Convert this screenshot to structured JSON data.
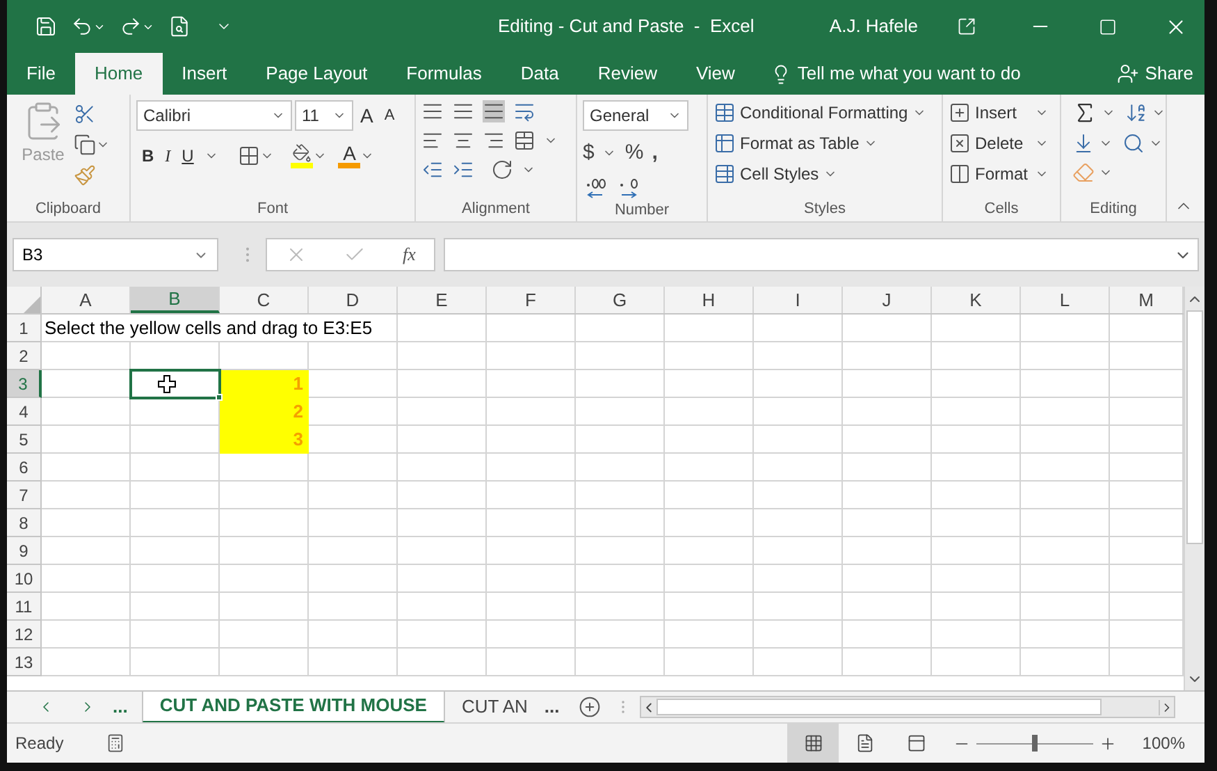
{
  "window": {
    "title": "Editing - Cut and Paste  -  Excel",
    "user": "A.J. Hafele"
  },
  "tabs": [
    {
      "label": "File",
      "selected": false
    },
    {
      "label": "Home",
      "selected": true
    },
    {
      "label": "Insert",
      "selected": false
    },
    {
      "label": "Page Layout",
      "selected": false
    },
    {
      "label": "Formulas",
      "selected": false
    },
    {
      "label": "Data",
      "selected": false
    },
    {
      "label": "Review",
      "selected": false
    },
    {
      "label": "View",
      "selected": false
    }
  ],
  "tell_me": {
    "placeholder": "Tell me what you want to do"
  },
  "share": "Share",
  "ribbon": {
    "clipboard": {
      "label": "Clipboard",
      "paste": "Paste"
    },
    "font": {
      "label": "Font",
      "name": "Calibri",
      "size": "11",
      "grow": "A",
      "shrink": "A",
      "bold": "B",
      "italic": "I",
      "underline": "U",
      "font_color": "A"
    },
    "alignment": {
      "label": "Alignment"
    },
    "number": {
      "label": "Number",
      "format": "General",
      "currency": "$",
      "percent": "%",
      "comma": ","
    },
    "styles": {
      "label": "Styles",
      "items": [
        "Conditional Formatting",
        "Format as Table",
        "Cell Styles"
      ]
    },
    "cells": {
      "label": "Cells",
      "items": [
        "Insert",
        "Delete",
        "Format"
      ]
    },
    "editing": {
      "label": "Editing"
    }
  },
  "formula_bar": {
    "name_box": "B3",
    "function_label": "fx"
  },
  "columns": [
    {
      "label": "A",
      "selected": false
    },
    {
      "label": "B",
      "selected": true
    },
    {
      "label": "C",
      "selected": false
    },
    {
      "label": "D",
      "selected": false
    },
    {
      "label": "E",
      "selected": false
    },
    {
      "label": "F",
      "selected": false
    },
    {
      "label": "G",
      "selected": false
    },
    {
      "label": "H",
      "selected": false
    },
    {
      "label": "I",
      "selected": false
    },
    {
      "label": "J",
      "selected": false
    },
    {
      "label": "K",
      "selected": false
    },
    {
      "label": "L",
      "selected": false
    },
    {
      "label": "M",
      "selected": false
    }
  ],
  "rows": [
    {
      "label": "1",
      "selected": false,
      "cells": [
        {
          "kind": "text",
          "text": "Select the yellow cells and drag to E3:E5",
          "selected": false
        },
        {
          "kind": "empty",
          "selected": false
        },
        {
          "kind": "empty",
          "selected": false
        },
        {
          "kind": "empty",
          "selected": false
        },
        {
          "kind": "empty",
          "selected": false
        },
        {
          "kind": "empty",
          "selected": false
        },
        {
          "kind": "empty",
          "selected": false
        },
        {
          "kind": "empty",
          "selected": false
        },
        {
          "kind": "empty",
          "selected": false
        },
        {
          "kind": "empty",
          "selected": false
        },
        {
          "kind": "empty",
          "selected": false
        },
        {
          "kind": "empty",
          "selected": false
        },
        {
          "kind": "empty",
          "selected": false
        }
      ]
    },
    {
      "label": "2",
      "selected": false,
      "cells": [
        {
          "kind": "empty",
          "selected": false
        },
        {
          "kind": "empty",
          "selected": false
        },
        {
          "kind": "empty",
          "selected": false
        },
        {
          "kind": "empty",
          "selected": false
        },
        {
          "kind": "empty",
          "selected": false
        },
        {
          "kind": "empty",
          "selected": false
        },
        {
          "kind": "empty",
          "selected": false
        },
        {
          "kind": "empty",
          "selected": false
        },
        {
          "kind": "empty",
          "selected": false
        },
        {
          "kind": "empty",
          "selected": false
        },
        {
          "kind": "empty",
          "selected": false
        },
        {
          "kind": "empty",
          "selected": false
        },
        {
          "kind": "empty",
          "selected": false
        }
      ]
    },
    {
      "label": "3",
      "selected": true,
      "cells": [
        {
          "kind": "empty",
          "selected": false
        },
        {
          "kind": "empty",
          "selected": true
        },
        {
          "kind": "number",
          "text": "1",
          "color": "#ffff00",
          "selected": false
        },
        {
          "kind": "empty",
          "selected": false
        },
        {
          "kind": "empty",
          "selected": false
        },
        {
          "kind": "empty",
          "selected": false
        },
        {
          "kind": "empty",
          "selected": false
        },
        {
          "kind": "empty",
          "selected": false
        },
        {
          "kind": "empty",
          "selected": false
        },
        {
          "kind": "empty",
          "selected": false
        },
        {
          "kind": "empty",
          "selected": false
        },
        {
          "kind": "empty",
          "selected": false
        },
        {
          "kind": "empty",
          "selected": false
        }
      ]
    },
    {
      "label": "4",
      "selected": false,
      "cells": [
        {
          "kind": "empty",
          "selected": false
        },
        {
          "kind": "empty",
          "selected": false
        },
        {
          "kind": "number",
          "text": "2",
          "color": "#ffff00",
          "selected": false
        },
        {
          "kind": "empty",
          "selected": false
        },
        {
          "kind": "empty",
          "selected": false
        },
        {
          "kind": "empty",
          "selected": false
        },
        {
          "kind": "empty",
          "selected": false
        },
        {
          "kind": "empty",
          "selected": false
        },
        {
          "kind": "empty",
          "selected": false
        },
        {
          "kind": "empty",
          "selected": false
        },
        {
          "kind": "empty",
          "selected": false
        },
        {
          "kind": "empty",
          "selected": false
        },
        {
          "kind": "empty",
          "selected": false
        }
      ]
    },
    {
      "label": "5",
      "selected": false,
      "cells": [
        {
          "kind": "empty",
          "selected": false
        },
        {
          "kind": "empty",
          "selected": false
        },
        {
          "kind": "number",
          "text": "3",
          "color": "#ffff00",
          "selected": false
        },
        {
          "kind": "empty",
          "selected": false
        },
        {
          "kind": "empty",
          "selected": false
        },
        {
          "kind": "empty",
          "selected": false
        },
        {
          "kind": "empty",
          "selected": false
        },
        {
          "kind": "empty",
          "selected": false
        },
        {
          "kind": "empty",
          "selected": false
        },
        {
          "kind": "empty",
          "selected": false
        },
        {
          "kind": "empty",
          "selected": false
        },
        {
          "kind": "empty",
          "selected": false
        },
        {
          "kind": "empty",
          "selected": false
        }
      ]
    },
    {
      "label": "6",
      "selected": false,
      "cells": [
        {
          "kind": "empty",
          "selected": false
        },
        {
          "kind": "empty",
          "selected": false
        },
        {
          "kind": "empty",
          "selected": false
        },
        {
          "kind": "empty",
          "selected": false
        },
        {
          "kind": "empty",
          "selected": false
        },
        {
          "kind": "empty",
          "selected": false
        },
        {
          "kind": "empty",
          "selected": false
        },
        {
          "kind": "empty",
          "selected": false
        },
        {
          "kind": "empty",
          "selected": false
        },
        {
          "kind": "empty",
          "selected": false
        },
        {
          "kind": "empty",
          "selected": false
        },
        {
          "kind": "empty",
          "selected": false
        },
        {
          "kind": "empty",
          "selected": false
        }
      ]
    },
    {
      "label": "7",
      "selected": false,
      "cells": [
        {
          "kind": "empty",
          "selected": false
        },
        {
          "kind": "empty",
          "selected": false
        },
        {
          "kind": "empty",
          "selected": false
        },
        {
          "kind": "empty",
          "selected": false
        },
        {
          "kind": "empty",
          "selected": false
        },
        {
          "kind": "empty",
          "selected": false
        },
        {
          "kind": "empty",
          "selected": false
        },
        {
          "kind": "empty",
          "selected": false
        },
        {
          "kind": "empty",
          "selected": false
        },
        {
          "kind": "empty",
          "selected": false
        },
        {
          "kind": "empty",
          "selected": false
        },
        {
          "kind": "empty",
          "selected": false
        },
        {
          "kind": "empty",
          "selected": false
        }
      ]
    },
    {
      "label": "8",
      "selected": false,
      "cells": [
        {
          "kind": "empty",
          "selected": false
        },
        {
          "kind": "empty",
          "selected": false
        },
        {
          "kind": "empty",
          "selected": false
        },
        {
          "kind": "empty",
          "selected": false
        },
        {
          "kind": "empty",
          "selected": false
        },
        {
          "kind": "empty",
          "selected": false
        },
        {
          "kind": "empty",
          "selected": false
        },
        {
          "kind": "empty",
          "selected": false
        },
        {
          "kind": "empty",
          "selected": false
        },
        {
          "kind": "empty",
          "selected": false
        },
        {
          "kind": "empty",
          "selected": false
        },
        {
          "kind": "empty",
          "selected": false
        },
        {
          "kind": "empty",
          "selected": false
        }
      ]
    },
    {
      "label": "9",
      "selected": false,
      "cells": [
        {
          "kind": "empty",
          "selected": false
        },
        {
          "kind": "empty",
          "selected": false
        },
        {
          "kind": "empty",
          "selected": false
        },
        {
          "kind": "empty",
          "selected": false
        },
        {
          "kind": "empty",
          "selected": false
        },
        {
          "kind": "empty",
          "selected": false
        },
        {
          "kind": "empty",
          "selected": false
        },
        {
          "kind": "empty",
          "selected": false
        },
        {
          "kind": "empty",
          "selected": false
        },
        {
          "kind": "empty",
          "selected": false
        },
        {
          "kind": "empty",
          "selected": false
        },
        {
          "kind": "empty",
          "selected": false
        },
        {
          "kind": "empty",
          "selected": false
        }
      ]
    },
    {
      "label": "10",
      "selected": false,
      "cells": [
        {
          "kind": "empty",
          "selected": false
        },
        {
          "kind": "empty",
          "selected": false
        },
        {
          "kind": "empty",
          "selected": false
        },
        {
          "kind": "empty",
          "selected": false
        },
        {
          "kind": "empty",
          "selected": false
        },
        {
          "kind": "empty",
          "selected": false
        },
        {
          "kind": "empty",
          "selected": false
        },
        {
          "kind": "empty",
          "selected": false
        },
        {
          "kind": "empty",
          "selected": false
        },
        {
          "kind": "empty",
          "selected": false
        },
        {
          "kind": "empty",
          "selected": false
        },
        {
          "kind": "empty",
          "selected": false
        },
        {
          "kind": "empty",
          "selected": false
        }
      ]
    },
    {
      "label": "11",
      "selected": false,
      "cells": [
        {
          "kind": "empty",
          "selected": false
        },
        {
          "kind": "empty",
          "selected": false
        },
        {
          "kind": "empty",
          "selected": false
        },
        {
          "kind": "empty",
          "selected": false
        },
        {
          "kind": "empty",
          "selected": false
        },
        {
          "kind": "empty",
          "selected": false
        },
        {
          "kind": "empty",
          "selected": false
        },
        {
          "kind": "empty",
          "selected": false
        },
        {
          "kind": "empty",
          "selected": false
        },
        {
          "kind": "empty",
          "selected": false
        },
        {
          "kind": "empty",
          "selected": false
        },
        {
          "kind": "empty",
          "selected": false
        },
        {
          "kind": "empty",
          "selected": false
        }
      ]
    },
    {
      "label": "12",
      "selected": false,
      "cells": [
        {
          "kind": "empty",
          "selected": false
        },
        {
          "kind": "empty",
          "selected": false
        },
        {
          "kind": "empty",
          "selected": false
        },
        {
          "kind": "empty",
          "selected": false
        },
        {
          "kind": "empty",
          "selected": false
        },
        {
          "kind": "empty",
          "selected": false
        },
        {
          "kind": "empty",
          "selected": false
        },
        {
          "kind": "empty",
          "selected": false
        },
        {
          "kind": "empty",
          "selected": false
        },
        {
          "kind": "empty",
          "selected": false
        },
        {
          "kind": "empty",
          "selected": false
        },
        {
          "kind": "empty",
          "selected": false
        },
        {
          "kind": "empty",
          "selected": false
        }
      ]
    },
    {
      "label": "13",
      "selected": false,
      "cells": [
        {
          "kind": "empty",
          "selected": false
        },
        {
          "kind": "empty",
          "selected": false
        },
        {
          "kind": "empty",
          "selected": false
        },
        {
          "kind": "empty",
          "selected": false
        },
        {
          "kind": "empty",
          "selected": false
        },
        {
          "kind": "empty",
          "selected": false
        },
        {
          "kind": "empty",
          "selected": false
        },
        {
          "kind": "empty",
          "selected": false
        },
        {
          "kind": "empty",
          "selected": false
        },
        {
          "kind": "empty",
          "selected": false
        },
        {
          "kind": "empty",
          "selected": false
        },
        {
          "kind": "empty",
          "selected": false
        },
        {
          "kind": "empty",
          "selected": false
        }
      ]
    }
  ],
  "sheet_nav": {
    "before": "...",
    "after": "..."
  },
  "sheet_tabs": [
    {
      "label": "CUT AND PASTE WITH MOUSE",
      "selected": true
    },
    {
      "label": "CUT AN",
      "selected": false
    }
  ],
  "status_bar": {
    "text": "Ready",
    "views": [
      {
        "kind": "normal",
        "selected": true
      },
      {
        "kind": "page_layout",
        "selected": false
      },
      {
        "kind": "page_break",
        "selected": false
      }
    ],
    "level": 0.5,
    "zoom": "100%"
  }
}
